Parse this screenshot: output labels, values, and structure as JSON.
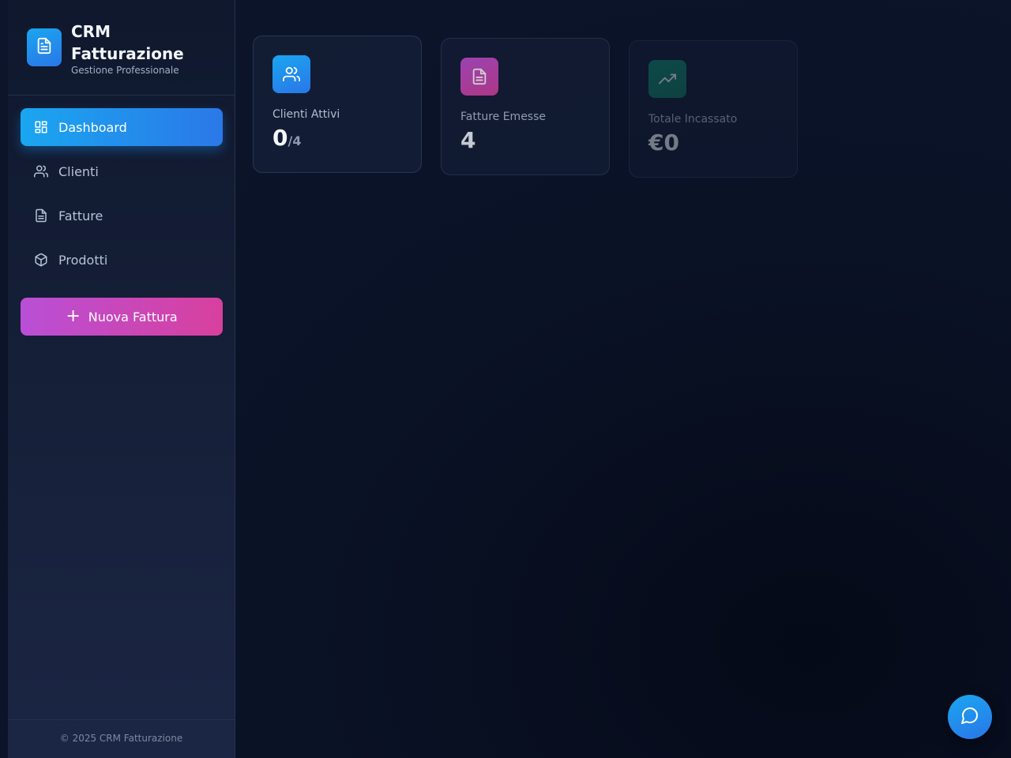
{
  "brand": {
    "title": "CRM Fatturazione",
    "subtitle": "Gestione Professionale",
    "logo_icon": "document-icon"
  },
  "nav": {
    "items": [
      {
        "label": "Dashboard",
        "icon": "dashboard-icon",
        "active": true
      },
      {
        "label": "Clienti",
        "icon": "users-icon",
        "active": false
      },
      {
        "label": "Fatture",
        "icon": "document-icon",
        "active": false
      },
      {
        "label": "Prodotti",
        "icon": "package-icon",
        "active": false
      }
    ]
  },
  "new_invoice": {
    "label": "Nuova Fattura",
    "icon": "plus-icon"
  },
  "footer": {
    "text": "© 2025 CRM Fatturazione"
  },
  "stats": [
    {
      "label": "Clienti Attivi",
      "value": "0",
      "sub": "/4",
      "icon": "users-icon"
    },
    {
      "label": "Fatture Emesse",
      "value": "4",
      "icon": "document-icon"
    },
    {
      "label": "Totale Incassato",
      "value": "€0",
      "icon": "trending-up-icon"
    }
  ],
  "chat": {
    "icon": "chat-bubble-icon"
  },
  "colors": {
    "accent_blue": "#1aa6f0",
    "accent_purple": "#c04fd4",
    "accent_pink": "#d8409e",
    "accent_green": "#0f8a6f",
    "background": "#0a1224"
  }
}
